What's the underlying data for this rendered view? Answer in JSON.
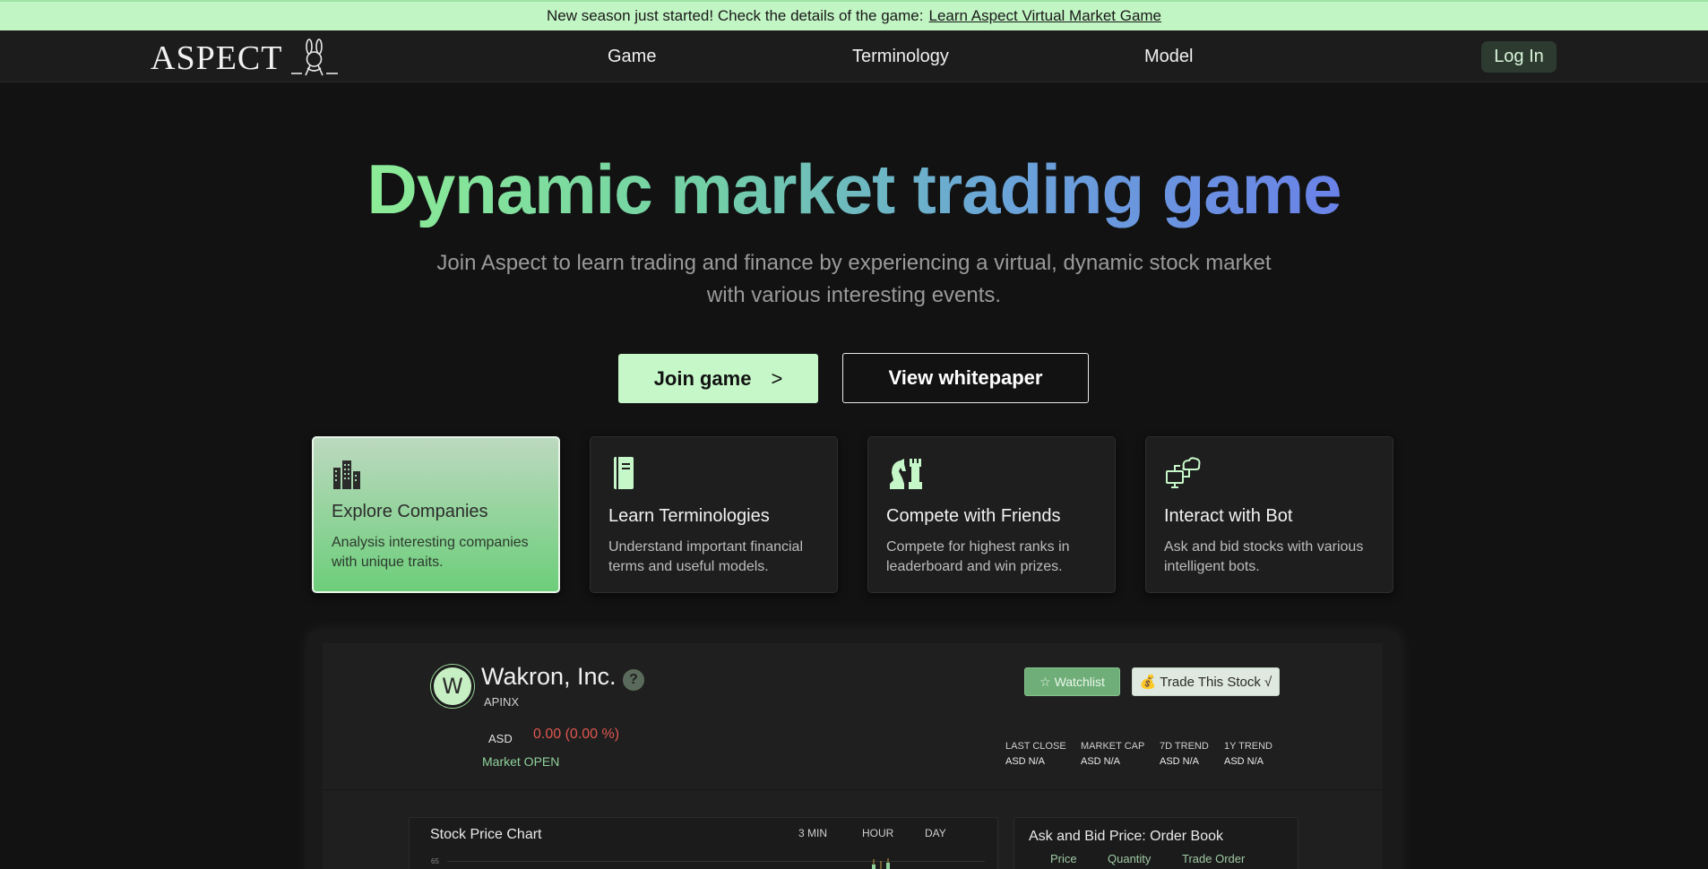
{
  "banner": {
    "text": "New season just started! Check the details of the game:",
    "link": "Learn Aspect Virtual Market Game"
  },
  "nav": {
    "logo": "ASPECT",
    "links": [
      "Game",
      "Terminology",
      "Model"
    ],
    "login": "Log In"
  },
  "hero": {
    "title": "Dynamic market trading game",
    "subtitle_line1": "Join Aspect to learn trading and finance by experiencing a virtual, dynamic stock market",
    "subtitle_line2": "with various interesting events.",
    "join_button": "Join game",
    "join_chevron": ">",
    "whitepaper_button": "View whitepaper"
  },
  "features": [
    {
      "icon": "buildings-icon",
      "title": "Explore Companies",
      "desc": "Analysis interesting companies with unique traits.",
      "active": true
    },
    {
      "icon": "book-icon",
      "title": "Learn Terminologies",
      "desc": "Understand important financial terms and useful models.",
      "active": false
    },
    {
      "icon": "chess-pieces-icon",
      "title": "Compete with Friends",
      "desc": "Compete for highest ranks in leaderboard and win prizes.",
      "active": false
    },
    {
      "icon": "bot-network-icon",
      "title": "Interact with Bot",
      "desc": "Ask and bid stocks with various intelligent bots.",
      "active": false
    }
  ],
  "preview": {
    "avatar": "W",
    "company": "Wakron, Inc.",
    "help": "?",
    "ticker": "APINX",
    "currency": "ASD",
    "price": "0.00 (0.00 %)",
    "market_status": "Market OPEN",
    "watchlist": "☆ Watchlist",
    "trade": "💰 Trade This Stock √",
    "stats": [
      {
        "label": "LAST CLOSE",
        "value": "ASD N/A"
      },
      {
        "label": "MARKET CAP",
        "value": "ASD N/A"
      },
      {
        "label": "7D TREND",
        "value": "ASD N/A"
      },
      {
        "label": "1Y TREND",
        "value": "ASD N/A"
      }
    ],
    "chart_title": "Stock Price Chart",
    "ranges": [
      "3 MIN",
      "HOUR",
      "DAY"
    ],
    "axis_top": "65",
    "orderbook_title": "Ask and Bid Price: Order Book",
    "orderbook_cols": [
      "Price",
      "Quantity",
      "Trade Order"
    ]
  },
  "colors": {
    "banner_bg": "#c2f5c4",
    "accent_green": "#c6f7c8",
    "price_red": "#e0574f",
    "gradient_start": "#8cec96",
    "gradient_end": "#6a82e8"
  }
}
